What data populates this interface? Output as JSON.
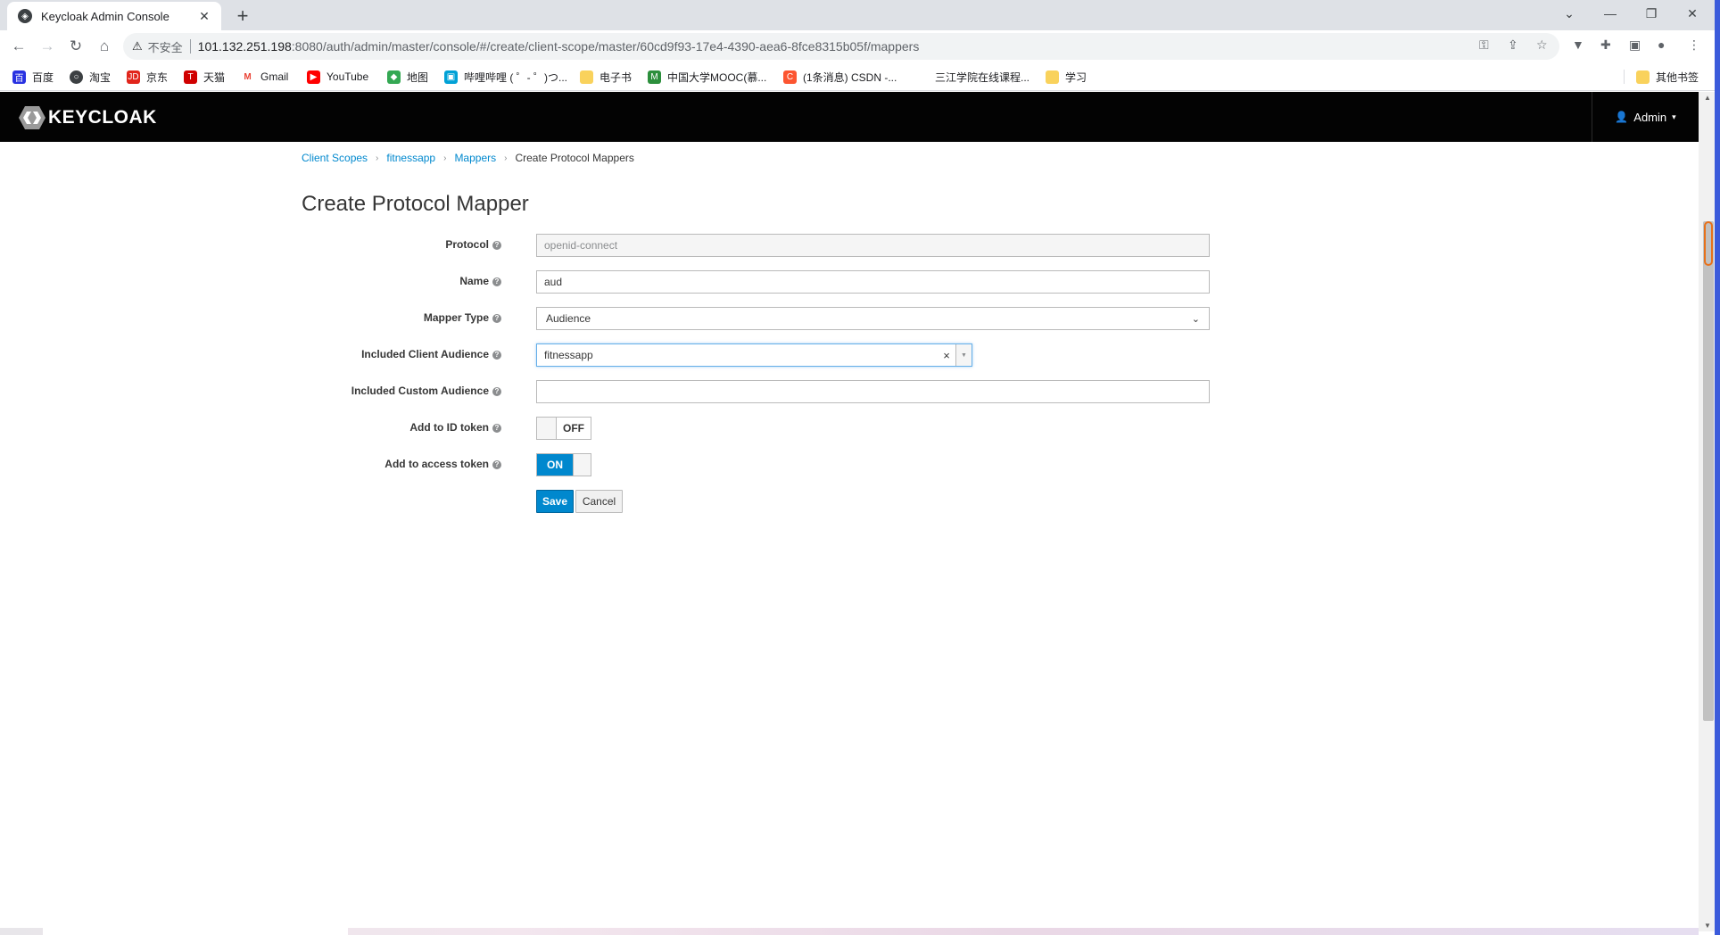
{
  "browser": {
    "tab_title": "Keycloak Admin Console",
    "new_tab": "+",
    "window_controls": {
      "dropdown": "⌄",
      "minimize": "—",
      "restore": "❐",
      "close": "✕"
    },
    "omnibox": {
      "warning": "⚠",
      "insecure_label": "不安全",
      "url_host": "101.132.251.198",
      "url_rest": ":8080/auth/admin/master/console/#/create/client-scope/master/60cd9f93-17e4-4390-aea6-8fce8315b05f/mappers"
    },
    "bookmarks": [
      {
        "label": "百度",
        "color": "#2932e1"
      },
      {
        "label": "淘宝",
        "color": "#3c4043"
      },
      {
        "label": "京东",
        "color": "#e1251b"
      },
      {
        "label": "天猫",
        "color": "#d00000"
      },
      {
        "label": "Gmail",
        "color": "#ea4335"
      },
      {
        "label": "YouTube",
        "color": "#ff0000"
      },
      {
        "label": "地图",
        "color": "#34a853"
      },
      {
        "label": "哔哩哔哩 ( ゜- ゜)つ...",
        "color": "#00a1d6"
      },
      {
        "label": "电子书",
        "color": "#f9d25c"
      },
      {
        "label": "中国大学MOOC(慕...",
        "color": "#2c8f3c"
      },
      {
        "label": "(1条消息) CSDN -...",
        "color": "#fc5531"
      },
      {
        "label": "三江学院在线课程...",
        "color": "#ffffff"
      },
      {
        "label": "学习",
        "color": "#f9d25c"
      }
    ],
    "other_bookmarks": "其他书签"
  },
  "header": {
    "logo_text": "KEYCLOAK",
    "user_label": "Admin"
  },
  "breadcrumb": {
    "items": [
      "Client Scopes",
      "fitnessapp",
      "Mappers"
    ],
    "current": "Create Protocol Mappers"
  },
  "page_title": "Create Protocol Mapper",
  "form": {
    "protocol": {
      "label": "Protocol",
      "value": "openid-connect"
    },
    "name": {
      "label": "Name",
      "value": "aud"
    },
    "mapper_type": {
      "label": "Mapper Type",
      "value": "Audience"
    },
    "included_client_audience": {
      "label": "Included Client Audience",
      "value": "fitnessapp"
    },
    "included_custom_audience": {
      "label": "Included Custom Audience",
      "value": ""
    },
    "add_to_id_token": {
      "label": "Add to ID token",
      "state": "OFF"
    },
    "add_to_access_token": {
      "label": "Add to access token",
      "state": "ON"
    },
    "save_label": "Save",
    "cancel_label": "Cancel"
  },
  "colors": {
    "accent": "#0088ce",
    "header_bg": "#030303",
    "link": "#0088ce"
  }
}
